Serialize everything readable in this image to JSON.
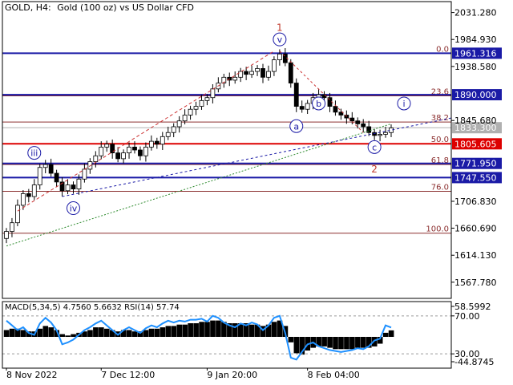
{
  "header": {
    "symbol": "GOLD, H4:",
    "description": "Gold (100 oz) vs US Dollar CFD"
  },
  "macd_label": "MACD(5,34,5) 4.7560 5.6632 RSI(14) 57.74",
  "chart_data": {
    "type": "candlestick",
    "price_axis": {
      "ticks": [
        "2031.280",
        "1984.930",
        "1938.580",
        "1845.680",
        "1706.830",
        "1660.690",
        "1614.130",
        "1567.780"
      ],
      "ylim": [
        1540,
        2050
      ]
    },
    "time_axis": {
      "labels": [
        "8 Nov 2022",
        "7 Dec 12:00",
        "9 Jan 20:00",
        "8 Feb 04:00"
      ]
    },
    "price_levels": [
      {
        "label": "1961.316",
        "value": 1961.316,
        "color": "#1a1aa6"
      },
      {
        "label": "1890.000",
        "value": 1890.0,
        "color": "#1a1aa6"
      },
      {
        "label": "1833.300",
        "value": 1833.3,
        "color": "#b0b0b0"
      },
      {
        "label": "1805.605",
        "value": 1805.605,
        "color": "#dd0000"
      },
      {
        "label": "1771.950",
        "value": 1771.95,
        "color": "#1a1aa6"
      },
      {
        "label": "1747.550",
        "value": 1747.55,
        "color": "#1a1aa6"
      }
    ],
    "fibonacci": [
      {
        "label": "0.0",
        "value": 1961.316
      },
      {
        "label": "23.6",
        "value": 1888.0
      },
      {
        "label": "38.2",
        "value": 1843.0
      },
      {
        "label": "50.0",
        "value": 1806.0
      },
      {
        "label": "61.8",
        "value": 1770.0
      },
      {
        "label": "76.0",
        "value": 1724.0
      },
      {
        "label": "100.0",
        "value": 1652.0
      }
    ],
    "wave_labels": [
      {
        "text": "iii",
        "color": "#1a1aa6",
        "circled": true
      },
      {
        "text": "iv",
        "color": "#1a1aa6",
        "circled": true
      },
      {
        "text": "v",
        "color": "#1a1aa6",
        "circled": true
      },
      {
        "text": "1",
        "color": "#c0392b",
        "circled": false
      },
      {
        "text": "a",
        "color": "#1a1aa6",
        "circled": true
      },
      {
        "text": "b",
        "color": "#1a1aa6",
        "circled": true
      },
      {
        "text": "c",
        "color": "#1a1aa6",
        "circled": true
      },
      {
        "text": "2",
        "color": "#c0392b",
        "circled": false
      },
      {
        "text": "i",
        "color": "#1a1aa6",
        "circled": true
      }
    ],
    "indicator_axis": {
      "ticks": [
        "58.5992",
        "70.00",
        "30.00",
        "-44.8745"
      ]
    },
    "series": [
      {
        "name": "GOLD",
        "close": [
          1655,
          1670,
          1700,
          1720,
          1715,
          1735,
          1765,
          1770,
          1755,
          1740,
          1725,
          1735,
          1728,
          1745,
          1762,
          1775,
          1785,
          1800,
          1805,
          1790,
          1780,
          1790,
          1800,
          1795,
          1785,
          1800,
          1810,
          1805,
          1818,
          1825,
          1835,
          1845,
          1855,
          1865,
          1870,
          1880,
          1885,
          1900,
          1910,
          1920,
          1915,
          1920,
          1930,
          1925,
          1930,
          1935,
          1920,
          1930,
          1950,
          1960,
          1945,
          1910,
          1870,
          1865,
          1875,
          1885,
          1890,
          1885,
          1870,
          1860,
          1855,
          1850,
          1845,
          1840,
          1835,
          1825,
          1820,
          1822,
          1825,
          1833
        ]
      },
      {
        "name": "MACD",
        "values": [
          5,
          6,
          6,
          5,
          4,
          4,
          6,
          8,
          7,
          5,
          2,
          1,
          2,
          3,
          4,
          5,
          7,
          7,
          6,
          5,
          4,
          5,
          5,
          4,
          4,
          5,
          6,
          6,
          7,
          8,
          8,
          9,
          9,
          10,
          10,
          11,
          11,
          12,
          12,
          11,
          10,
          10,
          10,
          10,
          9,
          9,
          8,
          9,
          11,
          12,
          8,
          -4,
          -12,
          -13,
          -10,
          -8,
          -7,
          -7,
          -8,
          -9,
          -9,
          -9,
          -9,
          -8,
          -8,
          -8,
          -7,
          -5,
          3,
          4.756
        ]
      },
      {
        "name": "RSI",
        "values": [
          65,
          60,
          55,
          58,
          52,
          50,
          62,
          68,
          63,
          55,
          40,
          42,
          45,
          50,
          55,
          58,
          62,
          65,
          60,
          55,
          50,
          55,
          58,
          55,
          52,
          57,
          60,
          58,
          62,
          65,
          63,
          65,
          64,
          66,
          66,
          67,
          64,
          70,
          68,
          63,
          60,
          58,
          62,
          60,
          63,
          61,
          55,
          60,
          68,
          70,
          52,
          26,
          24,
          32,
          40,
          42,
          38,
          36,
          34,
          33,
          32,
          33,
          34,
          36,
          35,
          38,
          44,
          46,
          60,
          57.74
        ]
      }
    ]
  }
}
